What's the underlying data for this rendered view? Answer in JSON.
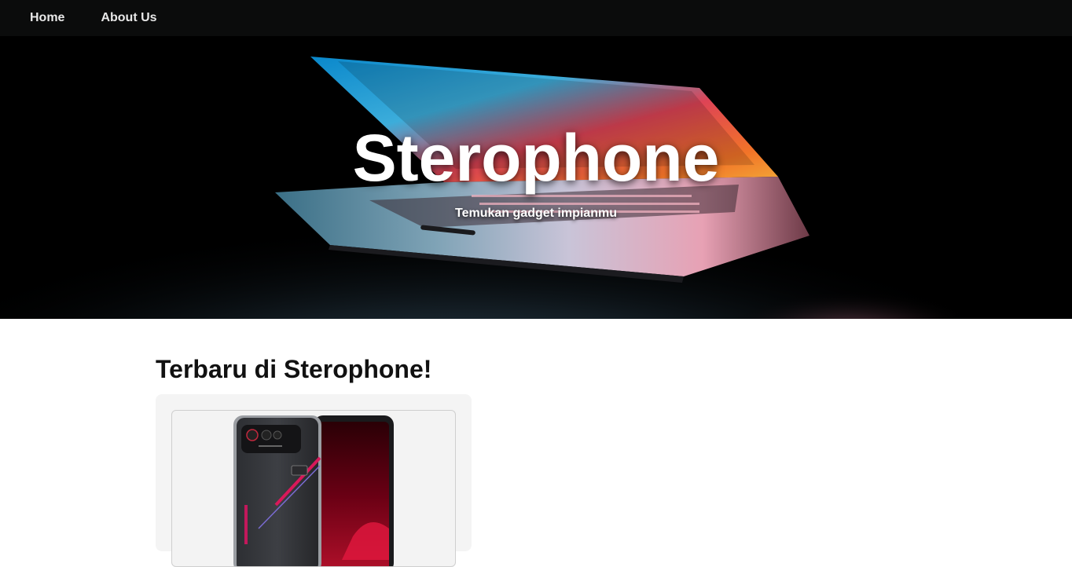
{
  "nav": {
    "items": [
      {
        "label": "Home"
      },
      {
        "label": "About Us"
      }
    ]
  },
  "hero": {
    "title": "Sterophone",
    "subtitle": "Temukan gadget impianmu"
  },
  "latest": {
    "heading": "Terbaru di Sterophone!",
    "products": [
      {
        "image_icon": "phone-product-image"
      }
    ]
  },
  "colors": {
    "nav_bg": "#0b0c0c",
    "card_bg": "#f4f4f4",
    "text_dark": "#111111"
  }
}
